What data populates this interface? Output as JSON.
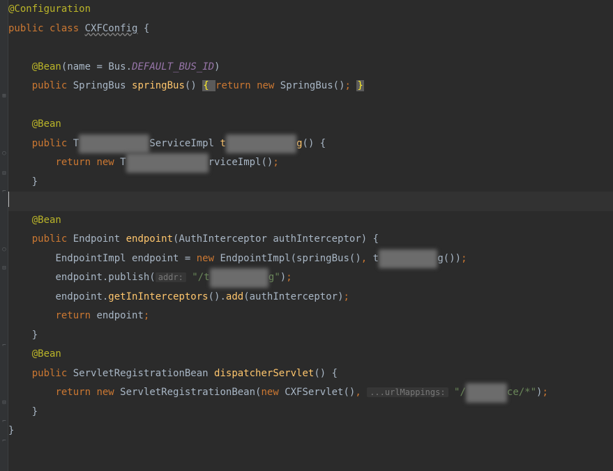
{
  "line1": {
    "annotation": "@Configuration"
  },
  "line2": {
    "kw1": "public ",
    "kw2": "class ",
    "name": "CXFConfig",
    "brace": " {"
  },
  "line4": {
    "annotation": "@Bean",
    "paren_open": "(",
    "label": "name = ",
    "cls": "Bus",
    "dot": ".",
    "field": "DEFAULT_BUS_ID",
    "paren_close": ")"
  },
  "line5": {
    "kw": "public ",
    "cls": "SpringBus ",
    "method": "springBus",
    "parens": "() ",
    "brace1": "{ ",
    "ret": "return ",
    "newkw": "new ",
    "cls2": "SpringBus()",
    "semi": ";",
    "sp": " ",
    "brace2": "}"
  },
  "line7": {
    "annotation": "@Bean"
  },
  "line8": {
    "kw": "public ",
    "cls1": "T",
    "blur1": "xxxxxxxxxxxx",
    "cls2": "ServiceImpl ",
    "method_t": "t",
    "blur2": "xxxxxxxxxxxx",
    "method_g": "g",
    "parens": "() {"
  },
  "line9": {
    "ret": "return ",
    "newkw": "new ",
    "cls_t": "T",
    "blur": "xxxxxxxxxxxxxx",
    "cls_rest": "rviceImpl()",
    "semi": ";"
  },
  "line10": {
    "brace": "}"
  },
  "line12": {
    "annotation": "@Bean"
  },
  "line13": {
    "kw": "public ",
    "cls": "Endpoint ",
    "method": "endpoint",
    "paren_open": "(",
    "param_type": "AuthInterceptor ",
    "param_name": "authInterceptor",
    "paren_close": ") {"
  },
  "line14": {
    "cls": "EndpointImpl ",
    "var": "endpoint = ",
    "newkw": "new ",
    "cls2": "EndpointImpl(",
    "call1": "springBus()",
    "comma": ", ",
    "call2_t": "t",
    "blur": "xxxxxxxxxx",
    "call2_end": "g())",
    "semi": ";"
  },
  "line15": {
    "obj": "endpoint.",
    "method": "publish(",
    "hint": "addr:",
    "sp": " ",
    "str1": "\"/t",
    "blur": "xxxxxxxxxx",
    "str2": "g\"",
    "close": ")",
    "semi": ";"
  },
  "line16": {
    "obj": "endpoint.",
    "m1": "getInInterceptors",
    "p1": "().",
    "m2": "add",
    "p2": "(",
    "arg": "authInterceptor",
    "p3": ")",
    "semi": ";"
  },
  "line17": {
    "ret": "return ",
    "var": "endpoint",
    "semi": ";"
  },
  "line18": {
    "brace": "}"
  },
  "line19": {
    "annotation": "@Bean"
  },
  "line20": {
    "kw": "public ",
    "cls": "ServletRegistrationBean ",
    "method": "dispatcherServlet",
    "parens": "() {"
  },
  "line21": {
    "ret": "return ",
    "newkw": "new ",
    "cls": "ServletRegistrationBean(",
    "newkw2": "new ",
    "cls2": "CXFServlet()",
    "comma": ", ",
    "hint": "...urlMappings:",
    "sp": " ",
    "str1": "\"/",
    "blur": "xxxxxxx",
    "str2": "ce/*\"",
    "close": ")",
    "semi": ";"
  },
  "line22": {
    "brace": "}"
  },
  "line23": {
    "brace": "}"
  }
}
